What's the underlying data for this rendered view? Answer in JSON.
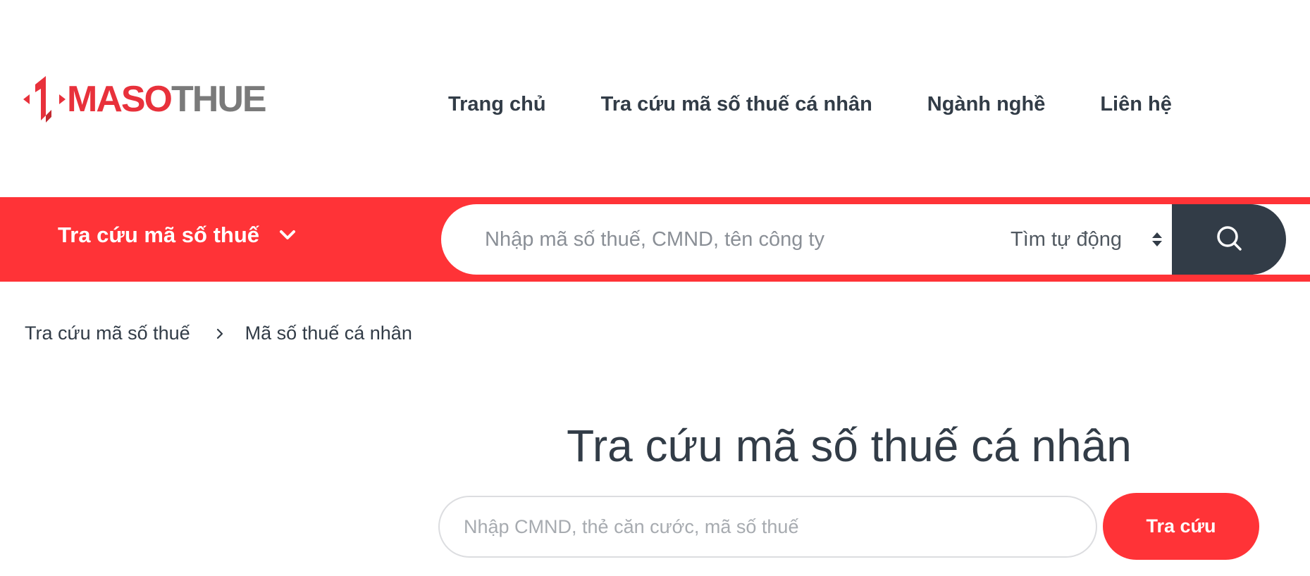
{
  "header": {
    "logo": {
      "text_red": "MASO",
      "text_gray": "THUE"
    },
    "nav": [
      {
        "label": "Trang chủ"
      },
      {
        "label": "Tra cứu mã số thuế cá nhân"
      },
      {
        "label": "Ngành nghề"
      },
      {
        "label": "Liên hệ"
      }
    ]
  },
  "search_bar": {
    "title": "Tra cứu mã số thuế",
    "input_placeholder": "Nhập mã số thuế, CMND, tên công ty",
    "input_value": "",
    "mode_selected": "Tìm tự động"
  },
  "breadcrumb": [
    {
      "label": "Tra cứu mã số thuế"
    },
    {
      "label": "Mã số thuế cá nhân"
    }
  ],
  "main": {
    "title": "Tra cứu mã số thuế cá nhân",
    "lookup_placeholder": "Nhập CMND, thẻ căn cước, mã số thuế",
    "lookup_value": "",
    "submit_label": "Tra cứu"
  },
  "colors": {
    "brand_red": "#ff3337",
    "dark": "#323c47",
    "logo_gray": "#7a7a7a"
  },
  "icons": {
    "logo_mark": "red-arrow-one-icon",
    "dropdown": "chevron-down-icon",
    "select": "up-down-caret-icon",
    "search": "search-icon",
    "breadcrumb_sep": "chevron-right-icon"
  }
}
